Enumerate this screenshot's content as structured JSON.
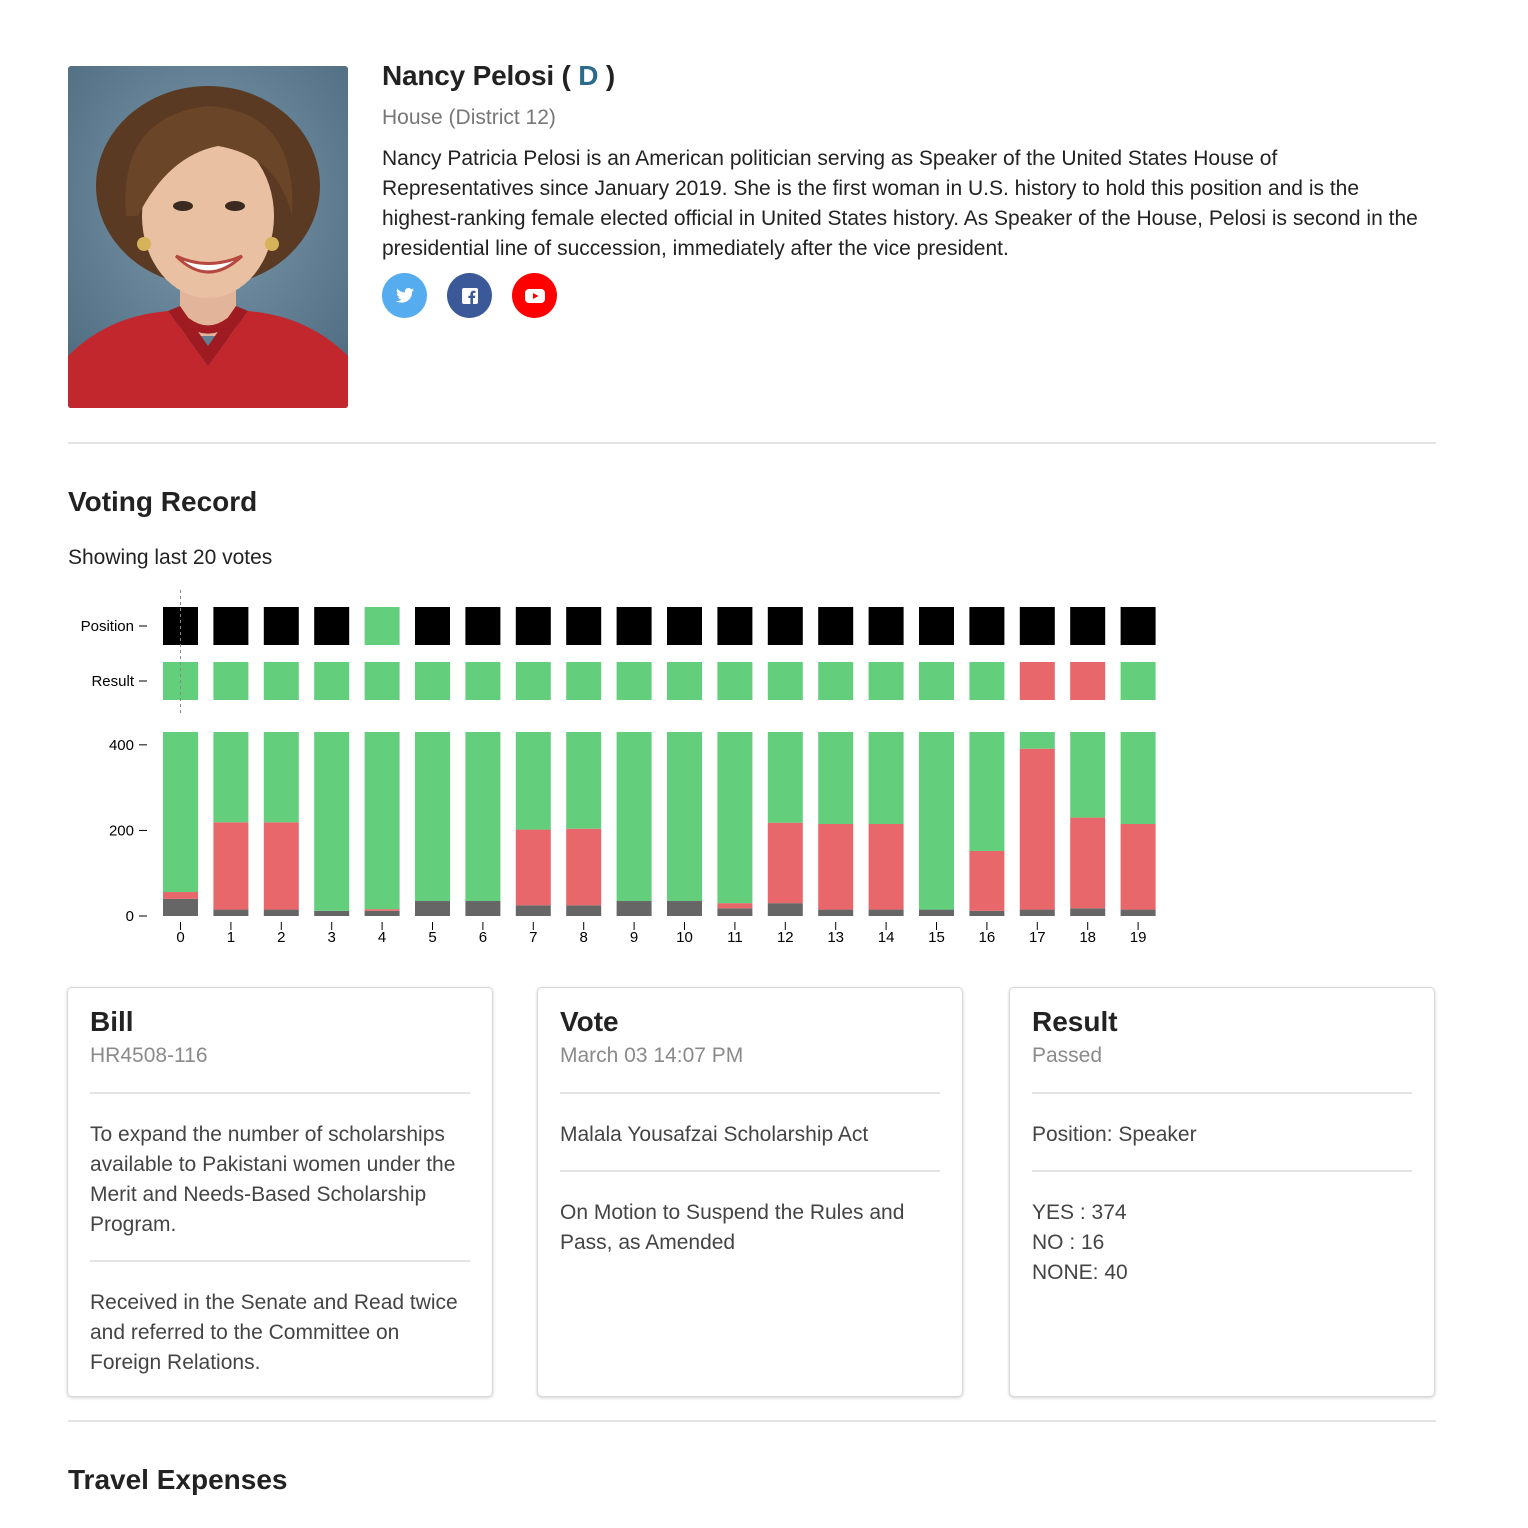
{
  "profile": {
    "name": "Nancy Pelosi",
    "party": "D",
    "chamber": "House (District 12)",
    "bio": "Nancy Patricia Pelosi is an American politician serving as Speaker of the United States House of Representatives since January 2019. She is the first woman in U.S. history to hold this position and is the highest-ranking female elected official in United States history. As Speaker of the House, Pelosi is second in the presidential line of succession, immediately after the vice president.",
    "social": [
      {
        "icon": "twitter-icon",
        "color": "#55acee"
      },
      {
        "icon": "facebook-icon",
        "color": "#3b5998"
      },
      {
        "icon": "youtube-icon",
        "color": "#ff0000"
      }
    ]
  },
  "voting": {
    "title": "Voting Record",
    "showing": "Showing last 20 votes"
  },
  "colors": {
    "yes": "#63cf7d",
    "no": "#e8676a",
    "none": "#666666",
    "position_other": "#000000"
  },
  "chart_data": {
    "type": "bar",
    "row_labels": [
      "Position",
      "Result"
    ],
    "categories": [
      "0",
      "1",
      "2",
      "3",
      "4",
      "5",
      "6",
      "7",
      "8",
      "9",
      "10",
      "11",
      "12",
      "13",
      "14",
      "15",
      "16",
      "17",
      "18",
      "19"
    ],
    "position": [
      "speaker",
      "speaker",
      "speaker",
      "speaker",
      "yes",
      "speaker",
      "speaker",
      "speaker",
      "speaker",
      "speaker",
      "speaker",
      "speaker",
      "speaker",
      "speaker",
      "speaker",
      "speaker",
      "speaker",
      "speaker",
      "speaker",
      "speaker"
    ],
    "result": [
      "passed",
      "passed",
      "passed",
      "passed",
      "passed",
      "passed",
      "passed",
      "passed",
      "passed",
      "passed",
      "passed",
      "passed",
      "passed",
      "passed",
      "passed",
      "passed",
      "passed",
      "failed",
      "failed",
      "passed"
    ],
    "series": [
      {
        "name": "NONE",
        "values": [
          40,
          15,
          15,
          12,
          12,
          35,
          35,
          25,
          25,
          35,
          35,
          18,
          30,
          15,
          15,
          15,
          12,
          15,
          18,
          15
        ]
      },
      {
        "name": "NO",
        "values": [
          16,
          204,
          204,
          0,
          4,
          0,
          0,
          177,
          179,
          0,
          0,
          12,
          188,
          200,
          200,
          0,
          140,
          376,
          212,
          200
        ]
      },
      {
        "name": "YES",
        "values": [
          374,
          211,
          211,
          418,
          414,
          395,
          395,
          228,
          226,
          395,
          395,
          400,
          212,
          215,
          215,
          415,
          278,
          39,
          200,
          215
        ]
      }
    ],
    "y_ticks": [
      "0",
      "200",
      "400"
    ],
    "ylim": [
      0,
      430
    ],
    "selected_index": 0
  },
  "cards": {
    "bill": {
      "title": "Bill",
      "id": "HR4508-116",
      "description": "To expand the number of scholarships available to Pakistani women under the Merit and Needs-Based Scholarship Program.",
      "status": "Received in the Senate and Read twice and referred to the Committee on Foreign Relations."
    },
    "vote": {
      "title": "Vote",
      "date": "March 03 14:07 PM",
      "name": "Malala Yousafzai Scholarship Act",
      "question": "On Motion to Suspend the Rules and Pass, as Amended"
    },
    "result": {
      "title": "Result",
      "status": "Passed",
      "position": "Position: Speaker",
      "yes": "YES : 374",
      "no": "NO : 16",
      "none": "NONE: 40"
    }
  },
  "travel": {
    "title": "Travel Expenses"
  }
}
